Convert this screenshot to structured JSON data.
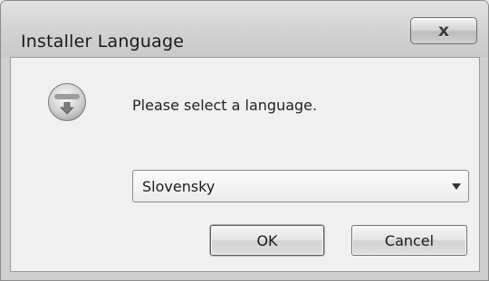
{
  "window": {
    "title": "Installer Language",
    "close_symbol": "x"
  },
  "dialog": {
    "icon": "installer-icon",
    "prompt": "Please select a language.",
    "language_select": {
      "selected": "Slovensky"
    },
    "buttons": {
      "ok_label": "OK",
      "cancel_label": "Cancel"
    }
  }
}
